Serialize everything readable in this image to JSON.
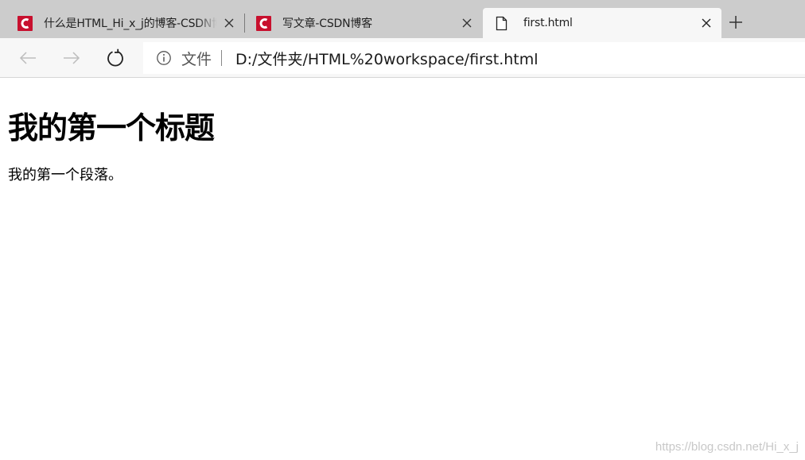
{
  "tabs": [
    {
      "title": "什么是HTML_Hi_x_j的博客-CSDN博客",
      "favicon": "csdn-logo-icon",
      "active": false
    },
    {
      "title": "写文章-CSDN博客",
      "favicon": "csdn-logo-icon",
      "active": false
    },
    {
      "title": "first.html",
      "favicon": "file-icon",
      "active": true
    }
  ],
  "address_bar": {
    "scheme_label": "文件",
    "url": "D:/文件夹/HTML%20workspace/first.html"
  },
  "page": {
    "heading": "我的第一个标题",
    "paragraph": "我的第一个段落。"
  },
  "watermark": "https://blog.csdn.net/Hi_x_j",
  "colors": {
    "tabbar_bg": "#cccccc",
    "active_tab_bg": "#f7f7f7",
    "csdn_red": "#c8102e"
  }
}
